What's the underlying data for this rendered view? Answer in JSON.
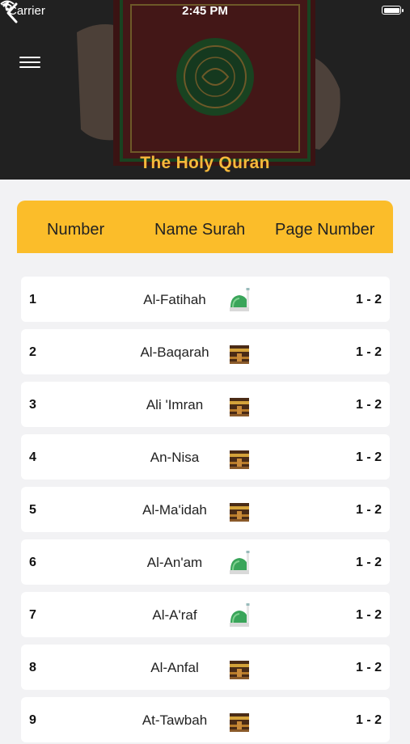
{
  "status_bar": {
    "carrier": "Carrier",
    "time": "2:45 PM"
  },
  "header": {
    "title": "The Holy Quran"
  },
  "table": {
    "columns": [
      "Number",
      "Name Surah",
      "Page Number"
    ],
    "rows": [
      {
        "number": "1",
        "name": "Al-Fatihah",
        "icon": "mosque-icon",
        "pages": "1 - 2"
      },
      {
        "number": "2",
        "name": "Al-Baqarah",
        "icon": "kaaba-icon",
        "pages": "1 - 2"
      },
      {
        "number": "3",
        "name": "Ali 'Imran",
        "icon": "kaaba-icon",
        "pages": "1 - 2"
      },
      {
        "number": "4",
        "name": "An-Nisa",
        "icon": "kaaba-icon",
        "pages": "1 - 2"
      },
      {
        "number": "5",
        "name": "Al-Ma'idah",
        "icon": "kaaba-icon",
        "pages": "1 - 2"
      },
      {
        "number": "6",
        "name": "Al-An'am",
        "icon": "mosque-icon",
        "pages": "1 - 2"
      },
      {
        "number": "7",
        "name": "Al-A'raf",
        "icon": "mosque-icon",
        "pages": "1 - 2"
      },
      {
        "number": "8",
        "name": "Al-Anfal",
        "icon": "kaaba-icon",
        "pages": "1 - 2"
      },
      {
        "number": "9",
        "name": "At-Tawbah",
        "icon": "kaaba-icon",
        "pages": "1 - 2"
      }
    ]
  },
  "colors": {
    "accent": "#fbbd2a",
    "title": "#f6b93b",
    "background": "#f2f2f4"
  }
}
